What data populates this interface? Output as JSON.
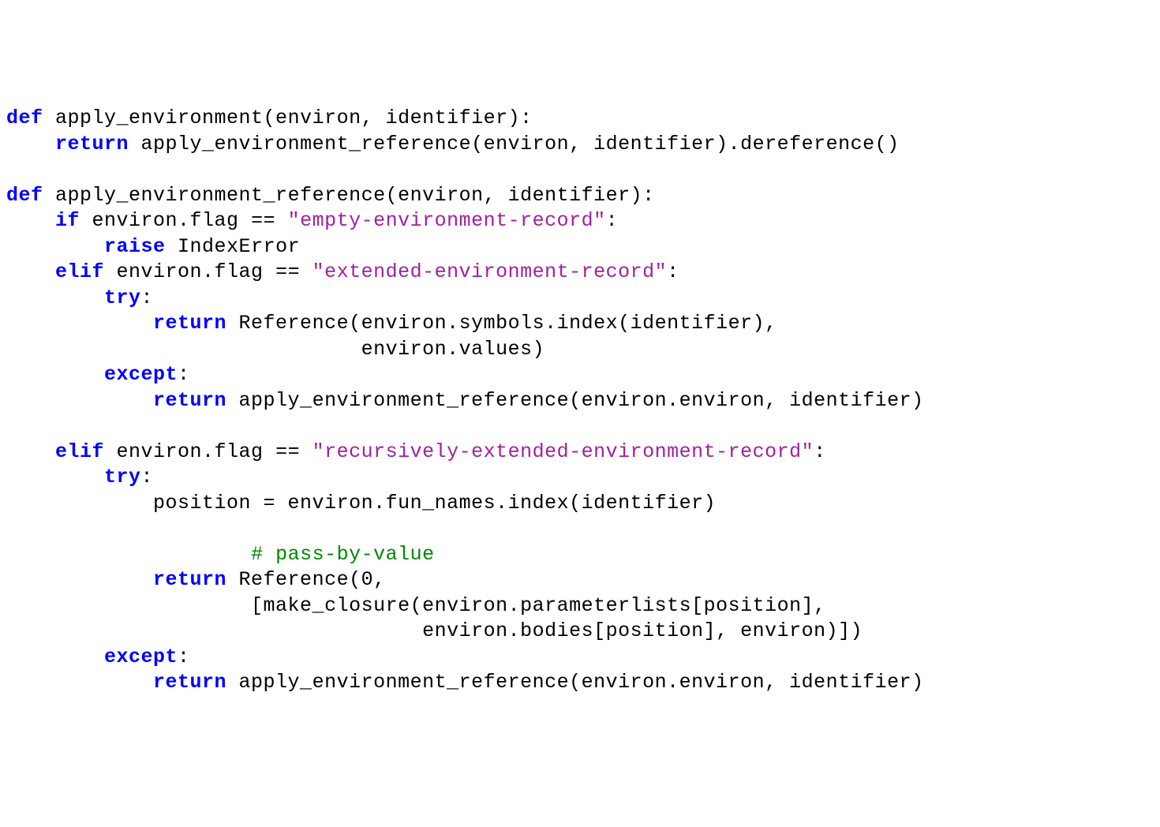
{
  "code": {
    "language": "python",
    "tokens": [
      {
        "line": 0,
        "spans": [
          {
            "t": "def",
            "c": "kw"
          },
          {
            "t": " apply_environment(environ, identifier):"
          }
        ]
      },
      {
        "line": 1,
        "spans": [
          {
            "t": "    "
          },
          {
            "t": "return",
            "c": "kw"
          },
          {
            "t": " apply_environment_reference(environ, identifier).dereference()"
          }
        ]
      },
      {
        "line": 2,
        "spans": [
          {
            "t": ""
          }
        ]
      },
      {
        "line": 3,
        "spans": [
          {
            "t": "def",
            "c": "kw"
          },
          {
            "t": " apply_environment_reference(environ, identifier):"
          }
        ]
      },
      {
        "line": 4,
        "spans": [
          {
            "t": "    "
          },
          {
            "t": "if",
            "c": "kw"
          },
          {
            "t": " environ.flag == "
          },
          {
            "t": "\"empty-environment-record\"",
            "c": "str"
          },
          {
            "t": ":"
          }
        ]
      },
      {
        "line": 5,
        "spans": [
          {
            "t": "        "
          },
          {
            "t": "raise",
            "c": "kw"
          },
          {
            "t": " IndexError"
          }
        ]
      },
      {
        "line": 6,
        "spans": [
          {
            "t": "    "
          },
          {
            "t": "elif",
            "c": "kw"
          },
          {
            "t": " environ.flag == "
          },
          {
            "t": "\"extended-environment-record\"",
            "c": "str"
          },
          {
            "t": ":"
          }
        ]
      },
      {
        "line": 7,
        "spans": [
          {
            "t": "        "
          },
          {
            "t": "try",
            "c": "kw"
          },
          {
            "t": ":"
          }
        ]
      },
      {
        "line": 8,
        "spans": [
          {
            "t": "            "
          },
          {
            "t": "return",
            "c": "kw"
          },
          {
            "t": " Reference(environ.symbols.index(identifier),"
          }
        ]
      },
      {
        "line": 9,
        "spans": [
          {
            "t": "                             environ.values)"
          }
        ]
      },
      {
        "line": 10,
        "spans": [
          {
            "t": "        "
          },
          {
            "t": "except",
            "c": "kw"
          },
          {
            "t": ":"
          }
        ]
      },
      {
        "line": 11,
        "spans": [
          {
            "t": "            "
          },
          {
            "t": "return",
            "c": "kw"
          },
          {
            "t": " apply_environment_reference(environ.environ, identifier)"
          }
        ]
      },
      {
        "line": 12,
        "spans": [
          {
            "t": ""
          }
        ]
      },
      {
        "line": 13,
        "spans": [
          {
            "t": "    "
          },
          {
            "t": "elif",
            "c": "kw"
          },
          {
            "t": " environ.flag == "
          },
          {
            "t": "\"recursively-extended-environment-record\"",
            "c": "str"
          },
          {
            "t": ":"
          }
        ]
      },
      {
        "line": 14,
        "spans": [
          {
            "t": "        "
          },
          {
            "t": "try",
            "c": "kw"
          },
          {
            "t": ":"
          }
        ]
      },
      {
        "line": 15,
        "spans": [
          {
            "t": "            position = environ.fun_names.index(identifier)"
          }
        ]
      },
      {
        "line": 16,
        "spans": [
          {
            "t": ""
          }
        ]
      },
      {
        "line": 17,
        "spans": [
          {
            "t": "                    "
          },
          {
            "t": "# pass-by-value",
            "c": "com"
          }
        ]
      },
      {
        "line": 18,
        "spans": [
          {
            "t": "            "
          },
          {
            "t": "return",
            "c": "kw"
          },
          {
            "t": " Reference(0,"
          }
        ]
      },
      {
        "line": 19,
        "spans": [
          {
            "t": "                    [make_closure(environ.parameterlists[position],"
          }
        ]
      },
      {
        "line": 20,
        "spans": [
          {
            "t": "                                  environ.bodies[position], environ)])"
          }
        ]
      },
      {
        "line": 21,
        "spans": [
          {
            "t": "        "
          },
          {
            "t": "except",
            "c": "kw"
          },
          {
            "t": ":"
          }
        ]
      },
      {
        "line": 22,
        "spans": [
          {
            "t": "            "
          },
          {
            "t": "return",
            "c": "kw"
          },
          {
            "t": " apply_environment_reference(environ.environ, identifier)"
          }
        ]
      }
    ]
  }
}
